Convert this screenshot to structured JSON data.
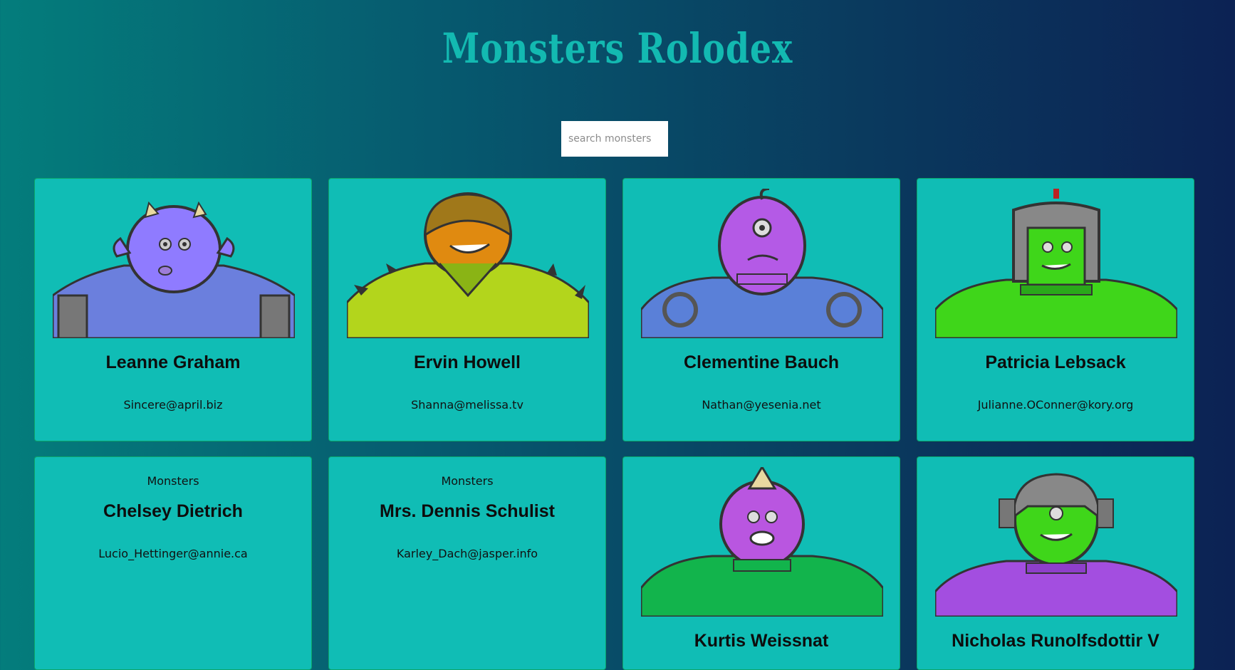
{
  "app": {
    "title": "Monsters Rolodex"
  },
  "search": {
    "placeholder": "search monsters",
    "value": ""
  },
  "monsters": [
    {
      "name": "Leanne Graham",
      "email": "Sincere@april.biz",
      "image": "purple-horned-monster",
      "colors": [
        "#8f7bff",
        "#6b7fdd"
      ]
    },
    {
      "name": "Ervin Howell",
      "email": "Shanna@melissa.tv",
      "image": "orange-spiky-monster",
      "colors": [
        "#e08a10",
        "#b3d51c"
      ]
    },
    {
      "name": "Clementine Bauch",
      "email": "Nathan@yesenia.net",
      "image": "purple-cyclops-robot-monster",
      "colors": [
        "#b45ae6",
        "#5a80d8"
      ]
    },
    {
      "name": "Patricia Lebsack",
      "email": "Julianne.OConner@kory.org",
      "image": "green-helmet-monster",
      "colors": [
        "#3fd61a",
        "#888888"
      ]
    },
    {
      "name": "Chelsey Dietrich",
      "email": "Lucio_Hettinger@annie.ca",
      "image_alt": "Monsters"
    },
    {
      "name": "Mrs. Dennis Schulist",
      "email": "Karley_Dach@jasper.info",
      "image_alt": "Monsters"
    },
    {
      "name": "Kurtis Weissnat",
      "email": "",
      "image": "purple-unicorn-monster",
      "colors": [
        "#b956e0",
        "#12b44c"
      ]
    },
    {
      "name": "Nicholas Runolfsdottir V",
      "email": "",
      "image": "green-robot-helmet-monster",
      "colors": [
        "#3fd61a",
        "#a34ee0"
      ]
    }
  ]
}
